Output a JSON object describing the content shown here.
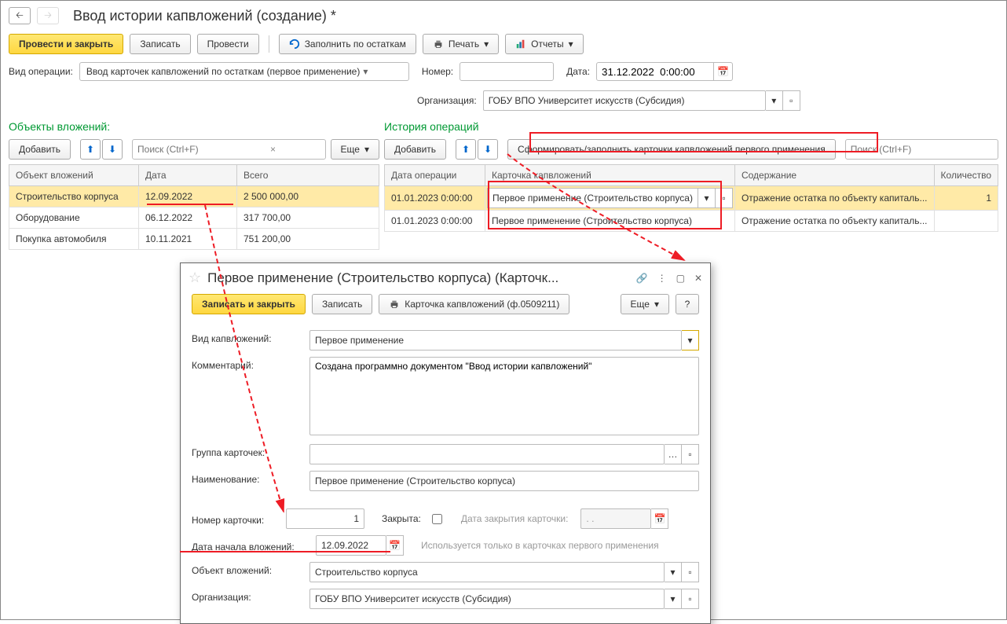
{
  "header": {
    "title": "Ввод истории капвложений (создание) *"
  },
  "toolbar": {
    "post_close": "Провести и закрыть",
    "write": "Записать",
    "post": "Провести",
    "fill_by": "Заполнить по остаткам",
    "print": "Печать",
    "reports": "Отчеты"
  },
  "form": {
    "op_type_lbl": "Вид операции:",
    "op_type_val": "Ввод карточек капвложений по остаткам (первое применение)",
    "num_lbl": "Номер:",
    "date_lbl": "Дата:",
    "date_val": "31.12.2022  0:00:00",
    "org_lbl": "Организация:",
    "org_val": "ГОБУ ВПО Университет искусств (Субсидия)"
  },
  "left": {
    "title": "Объекты вложений:",
    "add": "Добавить",
    "search_ph": "Поиск (Ctrl+F)",
    "more": "Еще",
    "cols": {
      "obj": "Объект вложений",
      "date": "Дата",
      "total": "Всего"
    },
    "rows": [
      {
        "obj": "Строительство корпуса",
        "date": "12.09.2022",
        "total": "2 500 000,00"
      },
      {
        "obj": "Оборудование",
        "date": "06.12.2022",
        "total": "317 700,00"
      },
      {
        "obj": "Покупка автомобиля",
        "date": "10.11.2021",
        "total": "751 200,00"
      }
    ]
  },
  "right": {
    "title": "История операций",
    "add": "Добавить",
    "form_btn": "Сформировать/заполнить карточки капвложений первого применения",
    "search_ph": "Поиск (Ctrl+F)",
    "cols": {
      "date": "Дата операции",
      "card": "Карточка капвложений",
      "content": "Содержание",
      "qty": "Количество"
    },
    "rows": [
      {
        "date": "01.01.2023 0:00:00",
        "card": "Первое применение (Строительство корпуса)",
        "content": "Отражение остатка по объекту капиталь...",
        "qty": "1"
      },
      {
        "date": "01.01.2023 0:00:00",
        "card": "Первое применение (Строительство корпуса)",
        "content": "Отражение остатка по объекту капиталь...",
        "qty": ""
      }
    ]
  },
  "popup": {
    "title": "Первое применение (Строительство корпуса) (Карточк...",
    "save_close": "Записать и закрыть",
    "write": "Записать",
    "print_card": "Карточка капвложений (ф.0509211)",
    "more": "Еще",
    "help": "?",
    "type_lbl": "Вид капвложений:",
    "type_val": "Первое применение",
    "comment_lbl": "Комментарий:",
    "comment_val": "Создана программно документом \"Ввод истории капвложений\"",
    "group_lbl": "Группа карточек:",
    "name_lbl": "Наименование:",
    "name_val": "Первое применение (Строительство корпуса)",
    "num_lbl": "Номер карточки:",
    "num_val": "1",
    "closed_lbl": "Закрыта:",
    "close_date_lbl": "Дата закрытия карточки:",
    "start_lbl": "Дата начала вложений:",
    "start_val": "12.09.2022",
    "start_hint": "Используется только в карточках первого применения",
    "obj_lbl": "Объект вложений:",
    "obj_val": "Строительство корпуса",
    "org_lbl": "Организация:",
    "org_val": "ГОБУ ВПО Университет искусств (Субсидия)"
  }
}
